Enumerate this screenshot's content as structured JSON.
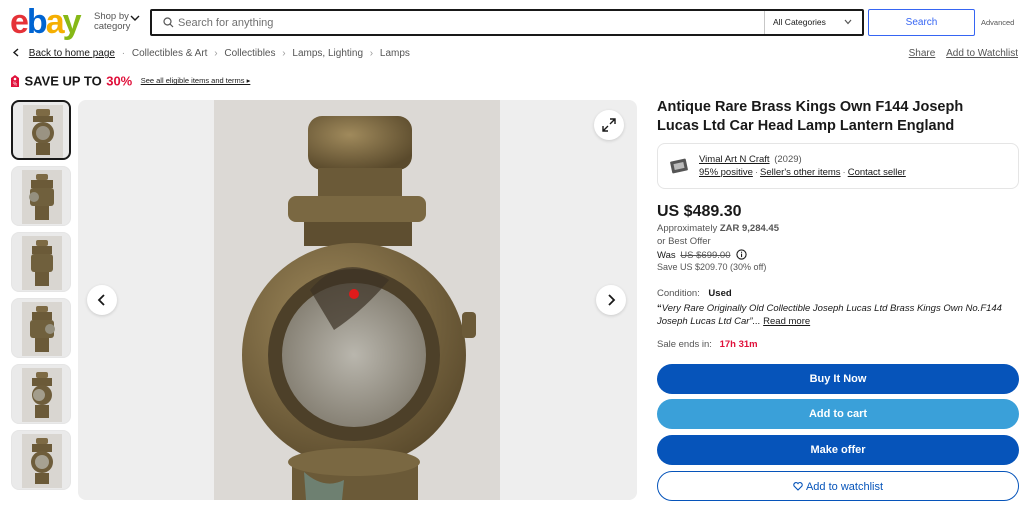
{
  "header": {
    "logo_letters": [
      {
        "ch": "e",
        "color": "#e53238"
      },
      {
        "ch": "b",
        "color": "#0064d2"
      },
      {
        "ch": "a",
        "color": "#f5af02"
      },
      {
        "ch": "y",
        "color": "#86b817"
      }
    ],
    "shop_by_line1": "Shop by",
    "shop_by_line2": "category",
    "search_placeholder": "Search for anything",
    "category_select": "All Categories",
    "search_button": "Search",
    "advanced": "Advanced"
  },
  "breadcrumb": {
    "back": "Back to home page",
    "items": [
      "Collectibles & Art",
      "Collectibles",
      "Lamps, Lighting",
      "Lamps"
    ],
    "share": "Share",
    "add_watchlist": "Add to Watchlist"
  },
  "promo": {
    "save_text": "SAVE UP TO",
    "percent": "30%",
    "terms": "See all eligible items and terms ▸"
  },
  "gallery": {
    "thumbnail_count": 6
  },
  "listing": {
    "title": "Antique Rare Brass Kings Own F144 Joseph Lucas Ltd Car Head Lamp Lantern England",
    "seller": {
      "name": "Vimal Art N Craft",
      "feedback_count": "(2029)",
      "positive": "95% positive",
      "other_items": "Seller's other items",
      "contact": "Contact seller"
    },
    "price": "US $489.30",
    "approx_label": "Approximately",
    "approx_value": "ZAR 9,284.45",
    "best_offer": "or Best Offer",
    "was_label": "Was",
    "was_price": "US $699.00",
    "save_line": "Save US $209.70 (30% off)",
    "condition_label": "Condition:",
    "condition_value": "Used",
    "description_quote": "“",
    "description": "Very Rare Originally Old Collectible Joseph Lucas Ltd Brass Kings Own No.F144 Joseph Lucas Ltd Car”...",
    "read_more": "Read more",
    "sale_ends_label": "Sale ends in:",
    "sale_ends_time": "17h 31m"
  },
  "actions": {
    "buy_now": "Buy It Now",
    "add_to_cart": "Add to cart",
    "make_offer": "Make offer",
    "add_to_watchlist": "Add to watchlist"
  }
}
